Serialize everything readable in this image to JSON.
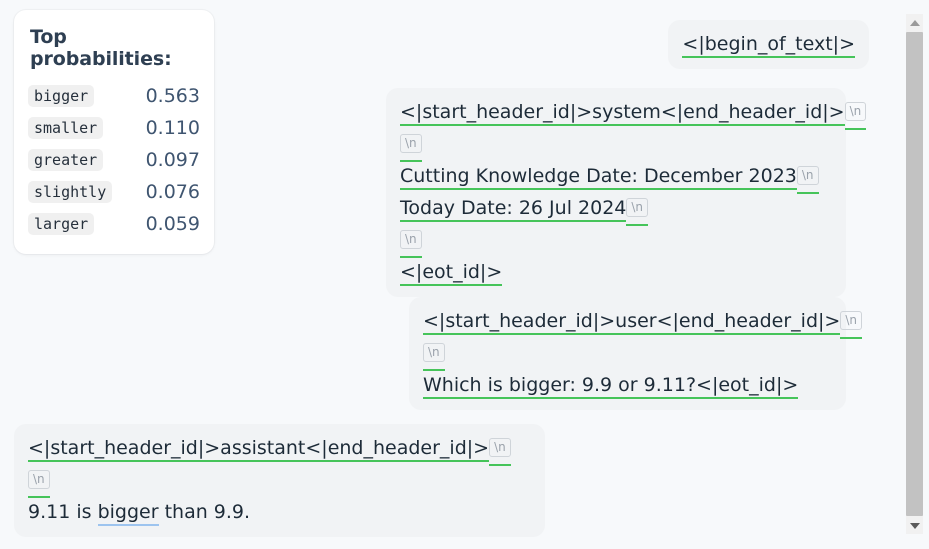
{
  "probabilities_panel": {
    "title": "Top probabilities:",
    "rows": [
      {
        "token": "bigger",
        "value": "0.563"
      },
      {
        "token": "smaller",
        "value": "0.110"
      },
      {
        "token": "greater",
        "value": "0.097"
      },
      {
        "token": "slightly",
        "value": "0.076"
      },
      {
        "token": "larger",
        "value": "0.059"
      }
    ]
  },
  "colors": {
    "page_background": "#f7f9fb",
    "card_background": "#ffffff",
    "bubble_background": "#f1f3f5",
    "token_underline": "#46c45a",
    "selected_token_underline": "#9dc4ef",
    "title_text": "#2e3f52",
    "value_text": "#3f5570",
    "newline_chip_text": "#9aa2ab",
    "scrollbar_thumb": "#c2c2c2",
    "scrollbar_track": "#f1f1f1"
  },
  "newline_glyph": "\\n",
  "messages": {
    "begin_of_text": {
      "line1": "<|begin_of_text|>"
    },
    "system": {
      "line1": "<|start_header_id|>system<|end_header_id|>",
      "line3": "Cutting Knowledge Date: December 2023",
      "line4": "Today Date: 26 Jul 2024",
      "line6": "<|eot_id|>"
    },
    "user": {
      "line1": "<|start_header_id|>user<|end_header_id|>",
      "line3": "Which is bigger: 9.9 or 9.11?<|eot_id|>"
    },
    "assistant": {
      "line1": "<|start_header_id|>assistant<|end_header_id|>",
      "line3_prefix": "9.11 is ",
      "line3_selected": "bigger",
      "line3_suffix": " than 9.9."
    }
  },
  "scrollbar": {
    "up_arrow": "scroll-up",
    "down_arrow": "scroll-down"
  }
}
